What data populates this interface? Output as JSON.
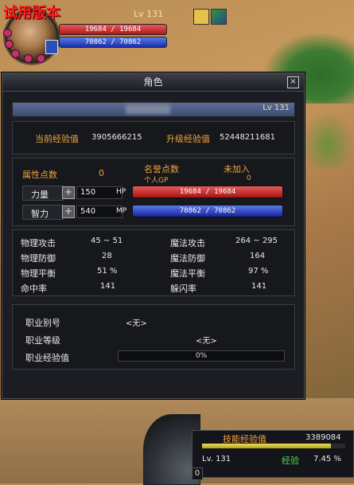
{
  "hud": {
    "version_label": "试用版本",
    "level": "Lv 131",
    "hp_text": "19684 / 19684",
    "mp_text": "70862 / 70862"
  },
  "window": {
    "title": "角色",
    "close_label": "×",
    "level": "Lv 131"
  },
  "exp": {
    "current_label": "当前经验值",
    "current_value": "3905666215",
    "next_label": "升级经验值",
    "next_value": "52448211681"
  },
  "points": {
    "attr_label": "属性点数",
    "attr_value": "0",
    "fame_label": "名誉点数",
    "fame_value": "未加入",
    "gp_label": "个人GP",
    "gp_value": "0"
  },
  "attributes": [
    {
      "label": "力量",
      "value": "150",
      "bar_tag": "HP",
      "bar_text": "19684 / 19684"
    },
    {
      "label": "智力",
      "value": "540",
      "bar_tag": "MP",
      "bar_text": "70862 / 70862"
    }
  ],
  "plus_label": "+",
  "combat": {
    "left": [
      {
        "label": "物理攻击",
        "value": "45 ~ 51"
      },
      {
        "label": "物理防御",
        "value": "28"
      },
      {
        "label": "物理平衡",
        "value": "51 %"
      },
      {
        "label": "命中率",
        "value": "141"
      }
    ],
    "right": [
      {
        "label": "魔法攻击",
        "value": "264 ~ 295"
      },
      {
        "label": "魔法防御",
        "value": "164"
      },
      {
        "label": "魔法平衡",
        "value": "97 %"
      },
      {
        "label": "躲闪率",
        "value": "141"
      }
    ]
  },
  "job": {
    "alias_label": "职业别号",
    "alias_value": "<无>",
    "level_label": "职业等级",
    "level_value": "<无>",
    "exp_label": "职业经验值",
    "exp_value": "0%"
  },
  "bottom": {
    "skill_exp_label": "技能经验值",
    "skill_exp_value": "3389084",
    "level": "Lv. 131",
    "exp_label": "经验",
    "exp_value": "7.45 %",
    "zero": "0"
  },
  "colors": {
    "hp": "#c42020",
    "mp": "#2436c0",
    "accent": "#f0a23a"
  }
}
